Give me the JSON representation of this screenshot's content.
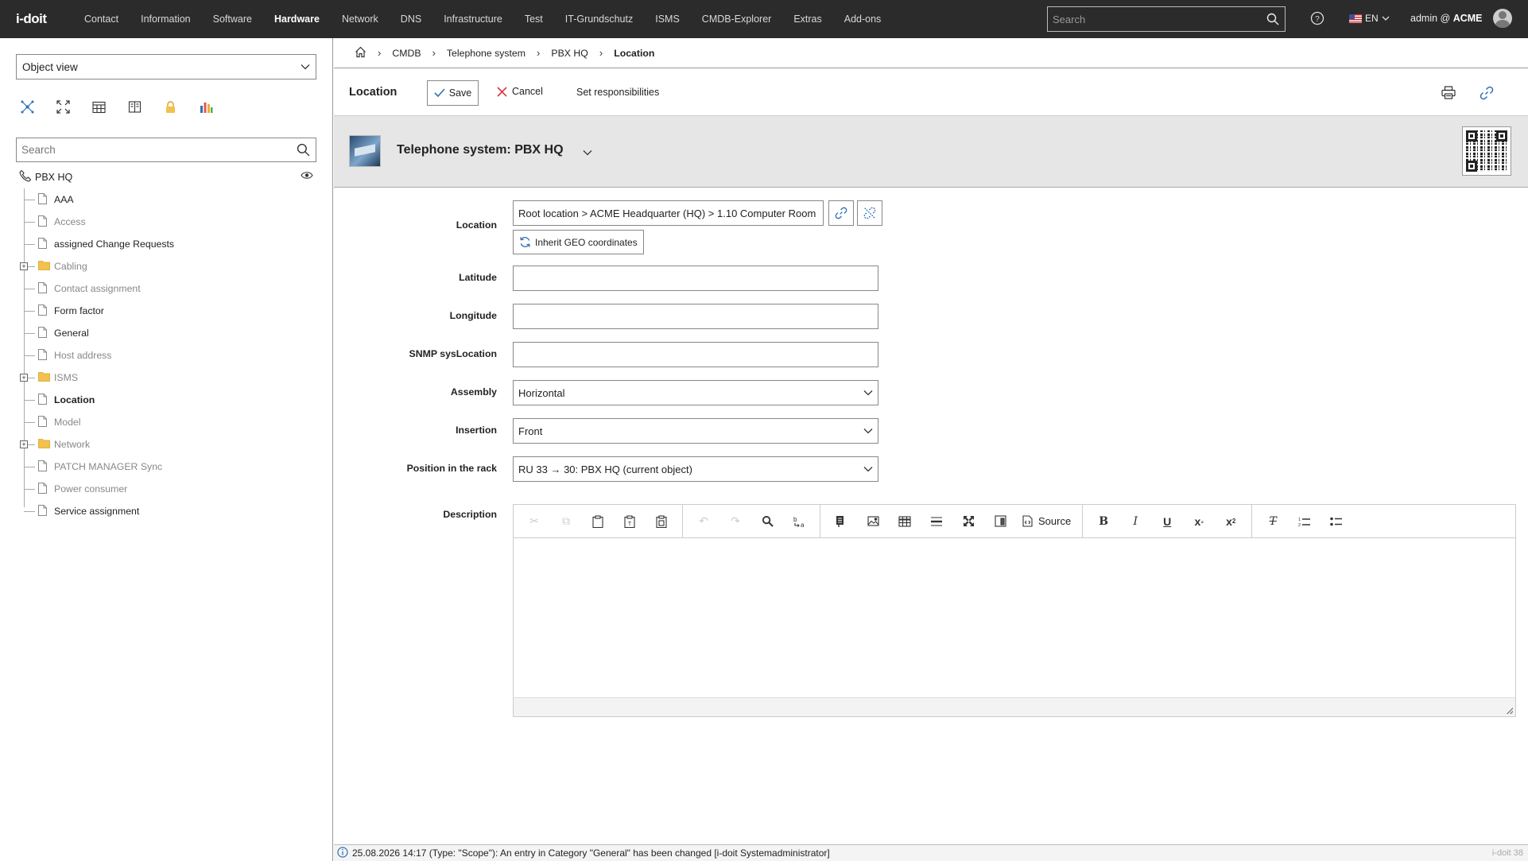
{
  "app": {
    "logo": "i-doit"
  },
  "nav": {
    "items": [
      {
        "label": "Contact"
      },
      {
        "label": "Information"
      },
      {
        "label": "Software"
      },
      {
        "label": "Hardware",
        "active": true
      },
      {
        "label": "Network"
      },
      {
        "label": "DNS"
      },
      {
        "label": "Infrastructure"
      },
      {
        "label": "Test"
      },
      {
        "label": "IT-Grundschutz"
      },
      {
        "label": "ISMS"
      },
      {
        "label": "CMDB-Explorer"
      },
      {
        "label": "Extras"
      },
      {
        "label": "Add-ons"
      }
    ],
    "search_placeholder": "Search",
    "language": "EN",
    "user_prefix": "admin @",
    "tenant": "ACME"
  },
  "sidebar": {
    "view_select": "Object view",
    "search_placeholder": "Search",
    "root": "PBX HQ",
    "items": [
      {
        "label": "AAA",
        "type": "page",
        "style": "normal"
      },
      {
        "label": "Access",
        "type": "page",
        "style": "grey"
      },
      {
        "label": "assigned Change Requests",
        "type": "page",
        "style": "normal"
      },
      {
        "label": "Cabling",
        "type": "folder",
        "style": "grey"
      },
      {
        "label": "Contact assignment",
        "type": "page",
        "style": "grey"
      },
      {
        "label": "Form factor",
        "type": "page",
        "style": "normal"
      },
      {
        "label": "General",
        "type": "page",
        "style": "normal"
      },
      {
        "label": "Host address",
        "type": "page",
        "style": "grey"
      },
      {
        "label": "ISMS",
        "type": "folder",
        "style": "grey"
      },
      {
        "label": "Location",
        "type": "page",
        "style": "bold"
      },
      {
        "label": "Model",
        "type": "page",
        "style": "grey"
      },
      {
        "label": "Network",
        "type": "folder",
        "style": "grey"
      },
      {
        "label": "PATCH MANAGER Sync",
        "type": "page",
        "style": "grey"
      },
      {
        "label": "Power consumer",
        "type": "page",
        "style": "grey"
      },
      {
        "label": "Service assignment",
        "type": "page",
        "style": "normal"
      }
    ]
  },
  "breadcrumb": [
    "CMDB",
    "Telephone system",
    "PBX HQ",
    "Location"
  ],
  "toolbar": {
    "title": "Location",
    "save": "Save",
    "cancel": "Cancel",
    "responsibilities": "Set responsibilities"
  },
  "object": {
    "title": "Telephone system: PBX HQ"
  },
  "form": {
    "location_label": "Location",
    "location_value": "Root location > ACME Headquarter (HQ) > 1.10 Computer Room",
    "inherit_geo": "Inherit GEO coordinates",
    "latitude_label": "Latitude",
    "latitude_value": "",
    "longitude_label": "Longitude",
    "longitude_value": "",
    "snmp_label": "SNMP sysLocation",
    "snmp_value": "",
    "assembly_label": "Assembly",
    "assembly_value": "Horizontal",
    "insertion_label": "Insertion",
    "insertion_value": "Front",
    "position_label": "Position in the rack",
    "position_value": "RU 33 → 30: PBX HQ (current object)",
    "description_label": "Description",
    "editor_source": "Source"
  },
  "status": {
    "message": "25.08.2026 14:17 (Type: \"Scope\"): An entry in Category \"General\" has been changed [i-doit Systemadministrator]",
    "version": "i-doit 38"
  },
  "colors": {
    "topbar": "#2b2b2b",
    "accent": "#2f6fb5",
    "folder": "#f2c14e"
  }
}
